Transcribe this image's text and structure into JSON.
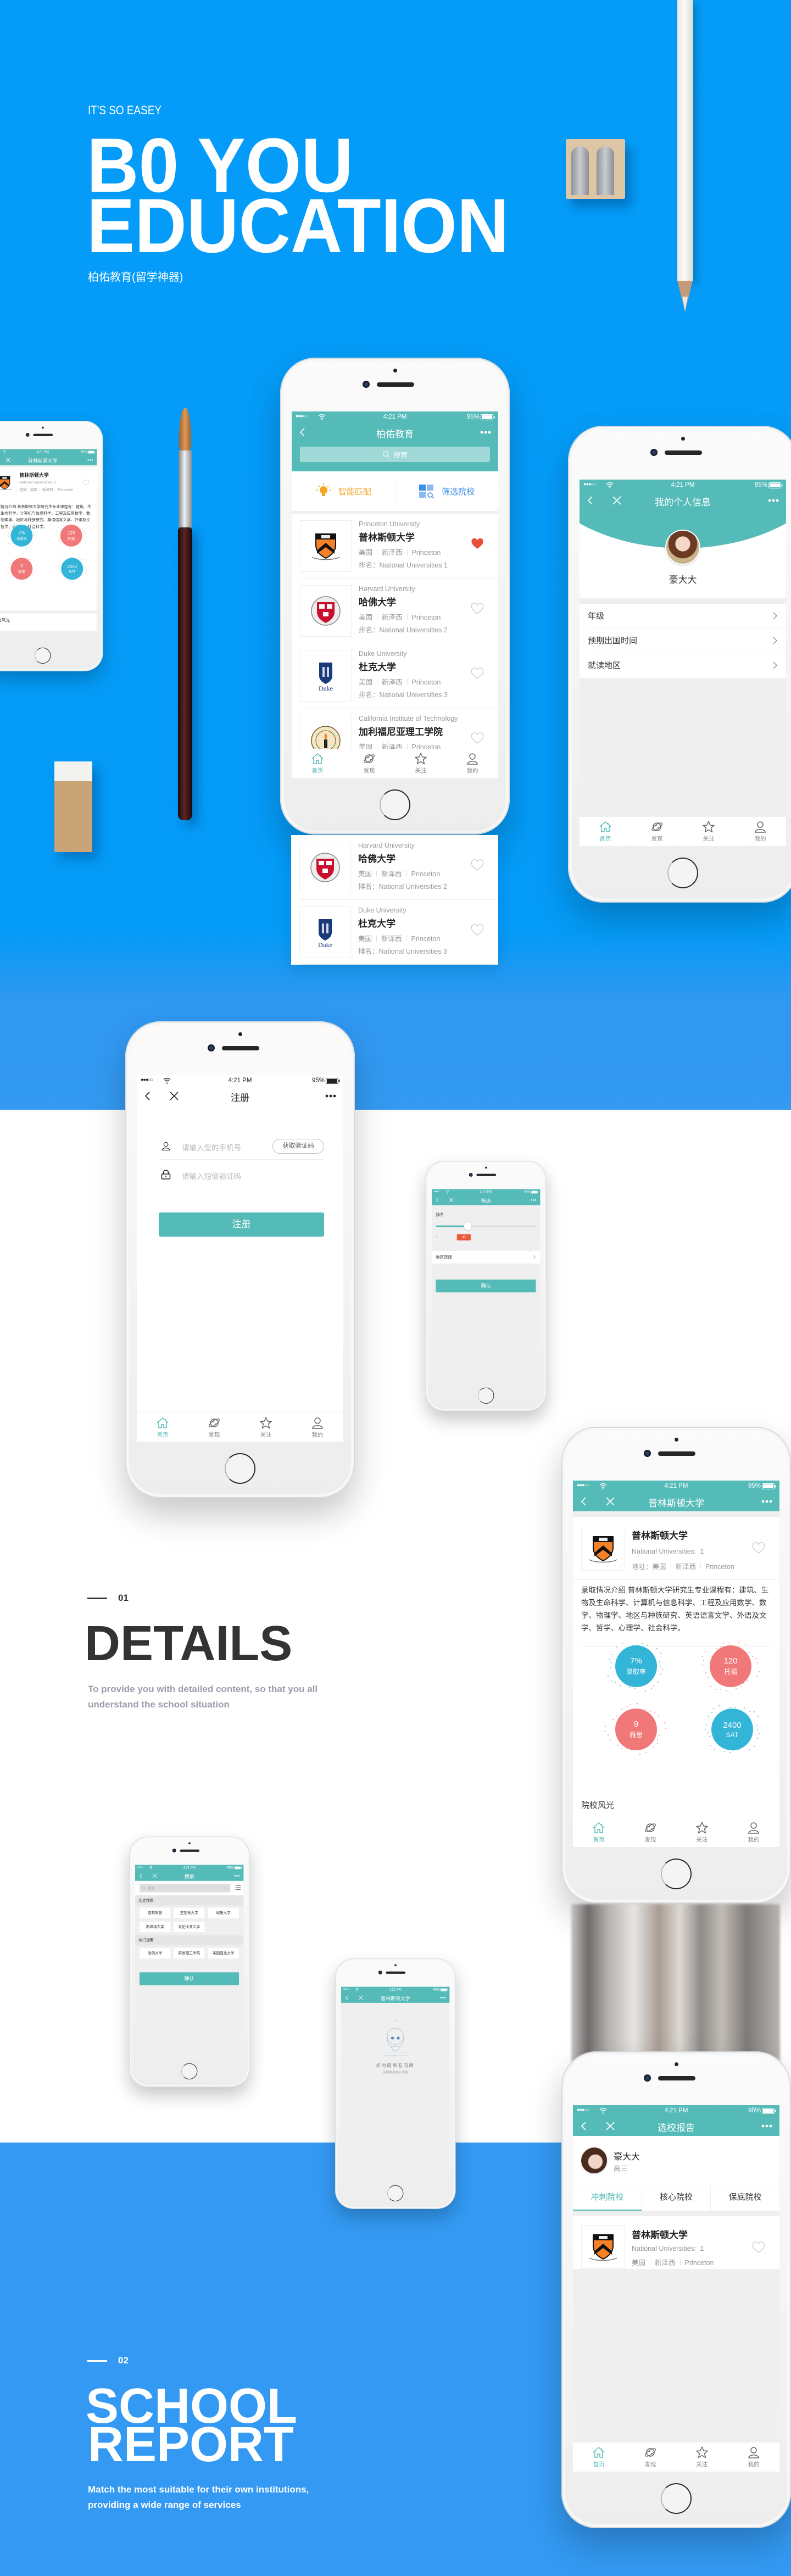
{
  "hero": {
    "kicker": "IT'S SO EASEY",
    "title_line1": "B0 YOU",
    "title_line2": "EDUCATION",
    "subtitle": "柏佑教育(留学神器)"
  },
  "colors": {
    "hero_blue": "#049cf8",
    "section_blue": "#3399f2",
    "teal": "#55bbb8",
    "orange": "#f5a623",
    "filter_blue": "#3a8ee6",
    "like_red": "#e8503a",
    "stat_blue": "#33b5d8",
    "stat_red": "#f07878"
  },
  "status": {
    "signal": "●●●○○",
    "time": "4:21 PM",
    "battery": "95%"
  },
  "tabbar": [
    {
      "label": "首页",
      "icon": "home-icon"
    },
    {
      "label": "发现",
      "icon": "planet-icon"
    },
    {
      "label": "关注",
      "icon": "star-icon"
    },
    {
      "label": "我的",
      "icon": "user-icon"
    }
  ],
  "home": {
    "title": "柏佑教育",
    "search_placeholder": "搜索",
    "filter_match": "智能匹配",
    "filter_select": "筛选院校",
    "rank_prefix": "排名：",
    "universities": [
      {
        "en": "Princeton University",
        "zh": "普林斯顿大学",
        "country": "美国",
        "state": "新泽西",
        "city": "Princeton",
        "rank": "National Universities 1",
        "liked": true
      },
      {
        "en": "Harvard University",
        "zh": "哈佛大学",
        "country": "美国",
        "state": "新泽西",
        "city": "Princeton",
        "rank": "National Universities 2",
        "liked": false
      },
      {
        "en": "Duke University",
        "zh": "杜克大学",
        "country": "美国",
        "state": "新泽西",
        "city": "Princeton",
        "rank": "National Universities 3",
        "liked": false
      },
      {
        "en": "California Institute of Technology",
        "zh": "加利福尼亚理工学院",
        "country": "美国",
        "state": "新泽西",
        "city": "Princeton",
        "liked": false
      }
    ]
  },
  "logos": {
    "duke_wordmark": "Duke"
  },
  "profile": {
    "title": "我的个人信息",
    "name": "豪大大",
    "items": [
      "年级",
      "预期出国时间",
      "就读地区"
    ]
  },
  "register": {
    "title": "注册",
    "phone_placeholder": "请输入您的手机号",
    "code_button": "获取验证码",
    "sms_placeholder": "请输入短信验证码",
    "submit": "注册"
  },
  "filter": {
    "title": "筛选",
    "rank_label": "排名",
    "slider_min": "1",
    "slider_value": "35",
    "region": "地区选择",
    "confirm": "确认"
  },
  "detail": {
    "title": "普林斯顿大学",
    "name": "普林斯顿大学",
    "rank_label": "National Universities:",
    "rank_value": "1",
    "address_label": "地址：",
    "country": "美国",
    "state": "新泽西",
    "city": "Princeton",
    "description": "录取情况介绍 普林斯顿大学研究生专业课程有：建筑、生物及生命科学、计算机与信息科学、工程及应用数学、数学、物理学、地区与种族研究、英语语言文学、外语及文学、哲学、心理学、社会科学。",
    "stats": [
      {
        "value": "7%",
        "label": "录取率"
      },
      {
        "value": "120",
        "label": "托福"
      },
      {
        "value": "9",
        "label": "雅思"
      },
      {
        "value": "2400",
        "label": "SAT"
      }
    ],
    "gallery_title": "院校风光"
  },
  "search": {
    "title": "搜索",
    "placeholder": "搜索",
    "history_title": "历史搜索",
    "history": [
      "普林斯顿",
      "芝加哥大学",
      "耶鲁大学",
      "斯坦福大学",
      "哥伦比亚大学"
    ],
    "hot_title": "热门搜索",
    "hot": [
      "哈佛大学",
      "麻省理工学院",
      "美国西北大学"
    ],
    "confirm": "确认"
  },
  "error": {
    "title": "普林斯顿大学",
    "message": "您的网络有问题",
    "hint": "轻触屏幕重新加载"
  },
  "report": {
    "title": "选校报告",
    "name": "豪大大",
    "grade": "高三",
    "tabs": [
      "冲刺院校",
      "核心院校",
      "保底院校"
    ],
    "active_tab": "冲刺院校",
    "school": {
      "name": "普林斯顿大学",
      "rank_label": "National Universities:",
      "rank_value": "1",
      "country": "美国",
      "state": "新泽西",
      "city": "Princeton"
    }
  },
  "details_section": {
    "number": "01",
    "title": "DETAILS",
    "desc": "To provide you with detailed content, so that you all understand the school situation"
  },
  "report_section": {
    "number": "02",
    "title_line1": "SCHOOL",
    "title_line2": "REPORT",
    "desc": "Match the most suitable for their own institutions, providing a wide range of services"
  }
}
